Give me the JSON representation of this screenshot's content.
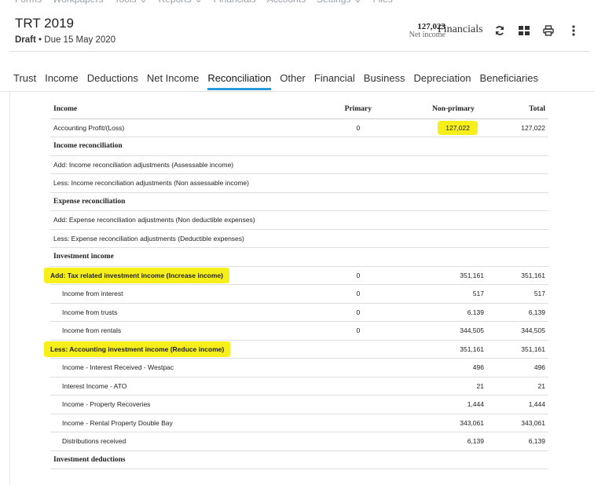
{
  "top_menu": [
    {
      "label": "Forms"
    },
    {
      "label": "Workpapers"
    },
    {
      "label": "Tools",
      "dropdown": true
    },
    {
      "label": "Reports",
      "dropdown": true
    },
    {
      "label": "Financials"
    },
    {
      "label": "Accounts"
    },
    {
      "label": "Settings",
      "dropdown": true
    },
    {
      "label": "Files"
    }
  ],
  "header": {
    "title": "TRT 2019",
    "status": "Draft",
    "due": "• Due 15 May 2020",
    "net_income_value": "127,023",
    "net_income_label": "Net income",
    "financials_label": "Financials",
    "icons": [
      "refresh-icon",
      "grid-icon",
      "print-icon",
      "more-vertical-icon"
    ]
  },
  "tabs": [
    {
      "label": "Trust"
    },
    {
      "label": "Income"
    },
    {
      "label": "Deductions"
    },
    {
      "label": "Net Income"
    },
    {
      "label": "Reconciliation",
      "active": true
    },
    {
      "label": "Other"
    },
    {
      "label": "Financial"
    },
    {
      "label": "Business"
    },
    {
      "label": "Depreciation"
    },
    {
      "label": "Beneficiaries"
    }
  ],
  "table": {
    "headers": {
      "label": "Income",
      "primary": "Primary",
      "nonprimary": "Non-primary",
      "total": "Total"
    },
    "rows": [
      {
        "label": "Accounting Profit/(Loss)",
        "primary": "0",
        "nonprimary": "127,022",
        "total": "127,022",
        "highlight_nonprimary": true
      },
      {
        "label": "Income reconciliation",
        "section": true
      },
      {
        "label": "Add: Income reconciliation adjustments (Assessable income)"
      },
      {
        "label": "Less: Income reconciliation adjustments (Non assessable income)"
      },
      {
        "label": "Expense reconciliation",
        "section": true
      },
      {
        "label": "Add: Expense reconciliation adjustments (Non deductible expenses)"
      },
      {
        "label": "Less: Expense reconciliation adjustments (Deductible expenses)"
      },
      {
        "label": "Investment income",
        "section": true
      },
      {
        "label": "Add: Tax related investment income (Increase income)",
        "primary": "0",
        "nonprimary": "351,161",
        "total": "351,161",
        "highlight_label": true
      },
      {
        "label": "Income from interest",
        "primary": "0",
        "nonprimary": "517",
        "total": "517",
        "indent": true
      },
      {
        "label": "Income from trusts",
        "primary": "0",
        "nonprimary": "6,139",
        "total": "6,139",
        "indent": true
      },
      {
        "label": "Income from rentals",
        "primary": "0",
        "nonprimary": "344,505",
        "total": "344,505",
        "indent": true
      },
      {
        "label": "Less: Accounting investment income (Reduce income)",
        "nonprimary": "351,161",
        "total": "351,161",
        "highlight_label": true
      },
      {
        "label": "Income - Interest Received - Westpac",
        "nonprimary": "496",
        "total": "496",
        "indent": true
      },
      {
        "label": "Interest Income - ATO",
        "nonprimary": "21",
        "total": "21",
        "indent": true
      },
      {
        "label": "Income - Property Recoveries",
        "nonprimary": "1,444",
        "total": "1,444",
        "indent": true
      },
      {
        "label": "Income - Rental Property Double Bay",
        "nonprimary": "343,061",
        "total": "343,061",
        "indent": true
      },
      {
        "label": "Distributions received",
        "nonprimary": "6,139",
        "total": "6,139",
        "indent": true
      },
      {
        "label": "Investment deductions",
        "section": true
      }
    ]
  },
  "colors": {
    "accent": "#2a9bd8",
    "highlight": "#f7ef1a"
  }
}
